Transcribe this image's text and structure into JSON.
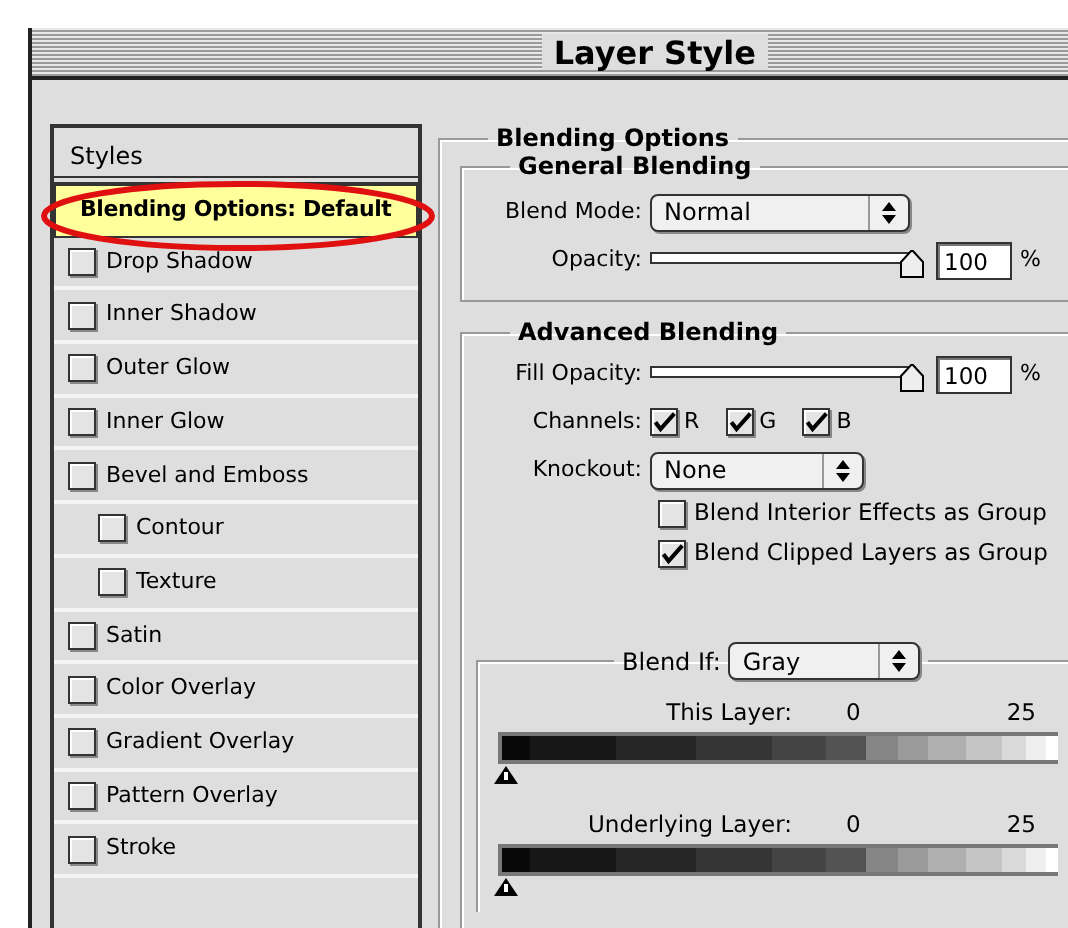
{
  "window": {
    "title": "Layer Style"
  },
  "styles_panel": {
    "header": "Styles",
    "items": [
      {
        "label": "Blending Options: Default",
        "kind": "header",
        "selected": true,
        "circled": true
      },
      {
        "label": "Drop Shadow",
        "kind": "effect",
        "selected": false,
        "checked": false
      },
      {
        "label": "Inner Shadow",
        "kind": "effect",
        "selected": false,
        "checked": false
      },
      {
        "label": "Outer Glow",
        "kind": "effect",
        "selected": false,
        "checked": false
      },
      {
        "label": "Inner Glow",
        "kind": "effect",
        "selected": false,
        "checked": false
      },
      {
        "label": "Bevel and Emboss",
        "kind": "effect",
        "selected": false,
        "checked": false,
        "children": [
          {
            "label": "Contour",
            "kind": "effect",
            "selected": false,
            "checked": false
          },
          {
            "label": "Texture",
            "kind": "effect",
            "selected": false,
            "checked": false
          }
        ]
      },
      {
        "label": "Satin",
        "kind": "effect",
        "selected": false,
        "checked": false
      },
      {
        "label": "Color Overlay",
        "kind": "effect",
        "selected": false,
        "checked": false
      },
      {
        "label": "Gradient Overlay",
        "kind": "effect",
        "selected": false,
        "checked": false
      },
      {
        "label": "Pattern Overlay",
        "kind": "effect",
        "selected": false,
        "checked": false
      },
      {
        "label": "Stroke",
        "kind": "effect",
        "selected": false,
        "checked": false
      }
    ]
  },
  "blending_options": {
    "title": "Blending Options",
    "general": {
      "title": "General Blending",
      "blend_mode": {
        "label": "Blend Mode:",
        "value": "Normal"
      },
      "opacity": {
        "label": "Opacity:",
        "level": 1,
        "value": "100",
        "unit": "%"
      }
    },
    "advanced": {
      "title": "Advanced Blending",
      "fill_opacity": {
        "label": "Fill Opacity:",
        "level": 1,
        "value": "100",
        "unit": "%"
      },
      "channels": {
        "label": "Channels:",
        "items": [
          {
            "label": "R",
            "checked": true
          },
          {
            "label": "G",
            "checked": true
          },
          {
            "label": "B",
            "checked": true
          }
        ]
      },
      "knockout": {
        "label": "Knockout:",
        "value": "None"
      },
      "options": [
        {
          "label": "Blend Interior Effects as Group",
          "checked": false
        },
        {
          "label": "Blend Clipped Layers as Group",
          "checked": true
        }
      ],
      "blend_if": {
        "label": "Blend If:",
        "value": "Gray",
        "sliders": [
          {
            "label": "This Layer:",
            "low": "0",
            "high": "25"
          },
          {
            "label": "Underlying Layer:",
            "low": "0",
            "high": "25"
          }
        ]
      }
    }
  }
}
